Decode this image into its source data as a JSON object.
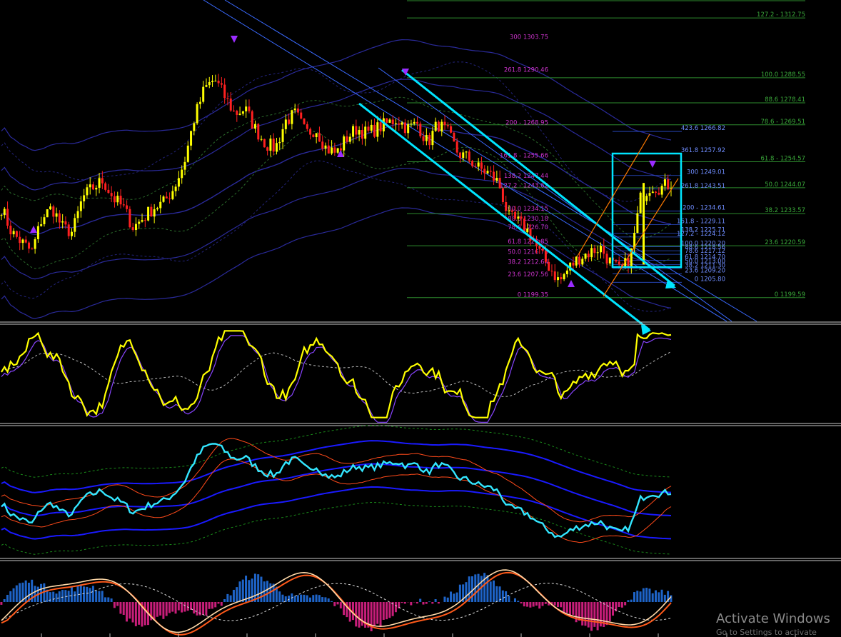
{
  "watermark": {
    "title": "Activate Windows",
    "subtitle": "Go to Settings to activate"
  },
  "colors": {
    "background": "#000000",
    "candle_up": "#ffff00",
    "candle_down": "#ff2020",
    "bands": "#2a2a9a",
    "channel": "#00e5ff",
    "fib_green": "#2e8b2e",
    "fib_label": "#cc33cc",
    "fib_blue": "#3a6aff",
    "indicator_yellow": "#ffff00",
    "indicator_purple": "#8844ff",
    "cyan_line": "#33e6ff",
    "hist_up": "#1e64c8",
    "hist_down": "#c81e7a",
    "orange": "#ff7a00"
  },
  "chart_data": [
    {
      "type": "candlestick",
      "panel": "price",
      "ylim": [
        1190,
        1320
      ],
      "close_path": [
        1236,
        1226,
        1222,
        1218,
        1232,
        1236,
        1228,
        1226,
        1240,
        1244,
        1247,
        1240,
        1236,
        1228,
        1232,
        1236,
        1238,
        1244,
        1254,
        1272,
        1284,
        1288,
        1281,
        1274,
        1276,
        1268,
        1262,
        1260,
        1271,
        1274,
        1266,
        1268,
        1260,
        1258,
        1264,
        1268,
        1266,
        1268,
        1270,
        1272,
        1268,
        1270,
        1262,
        1270,
        1266,
        1258,
        1256,
        1252,
        1250,
        1246,
        1232,
        1230,
        1226,
        1218,
        1212,
        1206,
        1212,
        1216,
        1218,
        1220,
        1214,
        1210,
        1216,
        1240,
        1245,
        1244,
        1246
      ],
      "marks": [
        {
          "label": "127.2 - 1312.75",
          "level": 1312.75,
          "color": "fib_green"
        },
        {
          "label": "100.0 1288.55",
          "level": 1288.55,
          "color": "fib_green"
        },
        {
          "label": "88.6 1278.41",
          "level": 1278.41,
          "color": "fib_green"
        },
        {
          "label": "78.6 - 1269.51",
          "level": 1269.51,
          "color": "fib_green"
        },
        {
          "label": "61.8 - 1254.57",
          "level": 1254.57,
          "color": "fib_green"
        },
        {
          "label": "50.0 1244.07",
          "level": 1244.07,
          "color": "fib_green"
        },
        {
          "label": "38.2 1233.57",
          "level": 1233.57,
          "color": "fib_green"
        },
        {
          "label": "23.6 1220.59",
          "level": 1220.59,
          "color": "fib_green"
        },
        {
          "label": "0 1199.59",
          "level": 1199.59,
          "color": "fib_green"
        }
      ],
      "fib_left": [
        {
          "label": "300 1303.75",
          "level": 1303.75
        },
        {
          "label": "261.8 1290.46",
          "level": 1290.46
        },
        {
          "label": "200 - 1268.95",
          "level": 1268.95
        },
        {
          "label": "161.8 - 1255.66",
          "level": 1255.66
        },
        {
          "label": "138.2 1247.44",
          "level": 1247.44
        },
        {
          "label": "127.2 - 1243.62",
          "level": 1243.62
        },
        {
          "label": "100.0 1234.15",
          "level": 1234.15
        },
        {
          "label": "88.6 1230.18",
          "level": 1230.18
        },
        {
          "label": "78.6 1226.70",
          "level": 1226.7
        },
        {
          "label": "61.8 1220.85",
          "level": 1220.85
        },
        {
          "label": "50.0 1216.75",
          "level": 1216.75
        },
        {
          "label": "38.2 1212.64",
          "level": 1212.64
        },
        {
          "label": "23.6 1207.56",
          "level": 1207.56
        },
        {
          "label": "0 1199.35",
          "level": 1199.35
        }
      ],
      "fib_right": [
        {
          "label": "423.6 1266.82",
          "level": 1266.82
        },
        {
          "label": "361.8 1257.92",
          "level": 1257.92
        },
        {
          "label": "300 1249.01",
          "level": 1249.01
        },
        {
          "label": "261.8 1243.51",
          "level": 1243.51
        },
        {
          "label": "200 - 1234.61",
          "level": 1234.61
        },
        {
          "label": "161.8 - 1229.11",
          "level": 1229.11
        },
        {
          "label": "138.2 1225.71",
          "level": 1225.71
        },
        {
          "label": "127.2 - 1224.12",
          "level": 1224.12
        },
        {
          "label": "100.0 1220.20",
          "level": 1220.2
        },
        {
          "label": "88.6 1218.56",
          "level": 1218.56
        },
        {
          "label": "78.6 1217.12",
          "level": 1217.12
        },
        {
          "label": "61.8 1214.70",
          "level": 1214.7
        },
        {
          "label": "50.0 1213.00",
          "level": 1213.0
        },
        {
          "label": "38.2 1211.30",
          "level": 1211.3
        },
        {
          "label": "23.6 1209.20",
          "level": 1209.2
        },
        {
          "label": "0 1205.80",
          "level": 1205.8
        }
      ]
    },
    {
      "type": "line",
      "panel": "oscillator",
      "series": [
        {
          "color": "indicator_yellow"
        },
        {
          "color": "indicator_purple"
        }
      ],
      "ylim": [
        0,
        100
      ]
    },
    {
      "type": "line",
      "panel": "bands-indicator",
      "series": [
        {
          "color": "cyan_line"
        }
      ],
      "ylim": [
        0,
        100
      ]
    },
    {
      "type": "bar",
      "panel": "histogram",
      "series": [
        {
          "color": "hist_up"
        },
        {
          "color": "hist_down"
        }
      ],
      "ylim": [
        -100,
        100
      ]
    }
  ]
}
